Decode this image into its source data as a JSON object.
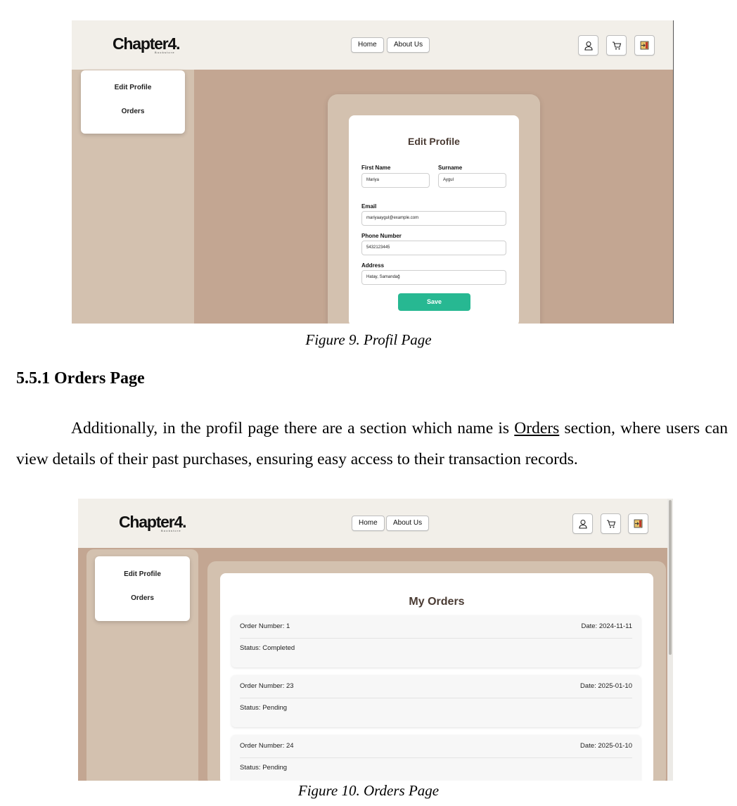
{
  "figure9": {
    "brand": {
      "name": "Chapter4.",
      "tagline": "Bookstore"
    },
    "nav": {
      "home": "Home",
      "about": "About Us"
    },
    "icons": [
      "user-icon",
      "cart-icon",
      "logout-icon"
    ],
    "sidebar": {
      "edit_profile": "Edit Profile",
      "orders": "Orders"
    },
    "form": {
      "title": "Edit Profile",
      "first_name_label": "First Name",
      "first_name_value": "Mariya",
      "surname_label": "Surname",
      "surname_value": "Aygul",
      "email_label": "Email",
      "email_value": "mariyaaygul@example.com",
      "phone_label": "Phone Number",
      "phone_value": "5432123445",
      "address_label": "Address",
      "address_value": "Hatay, Samandağ",
      "save_label": "Save"
    },
    "caption": "Figure 9. Profil Page"
  },
  "section": {
    "heading": "5.5.1 Orders Page",
    "para_before": "Additionally, in the profil page there are a section which name is ",
    "para_link": "Orders",
    "para_after": " section, where users can view details of their past purchases, ensuring easy access to their transaction records."
  },
  "figure10": {
    "brand": {
      "name": "Chapter4.",
      "tagline": "Bookstore"
    },
    "nav": {
      "home": "Home",
      "about": "About Us"
    },
    "sidebar": {
      "edit_profile": "Edit Profile",
      "orders": "Orders"
    },
    "title": "My Orders",
    "orders": [
      {
        "number": "Order Number: 1",
        "date": "Date: 2024-11-11",
        "status": "Status: Completed"
      },
      {
        "number": "Order Number: 23",
        "date": "Date: 2025-01-10",
        "status": "Status: Pending"
      },
      {
        "number": "Order Number: 24",
        "date": "Date: 2025-01-10",
        "status": "Status: Pending"
      }
    ],
    "caption": "Figure 10. Orders Page"
  },
  "colors": {
    "navbar_bg": "#f2efe9",
    "page_bg": "#c3a692",
    "panel_bg": "#d3c1af",
    "save_button": "#27b892",
    "title_text": "#4a3b33"
  }
}
